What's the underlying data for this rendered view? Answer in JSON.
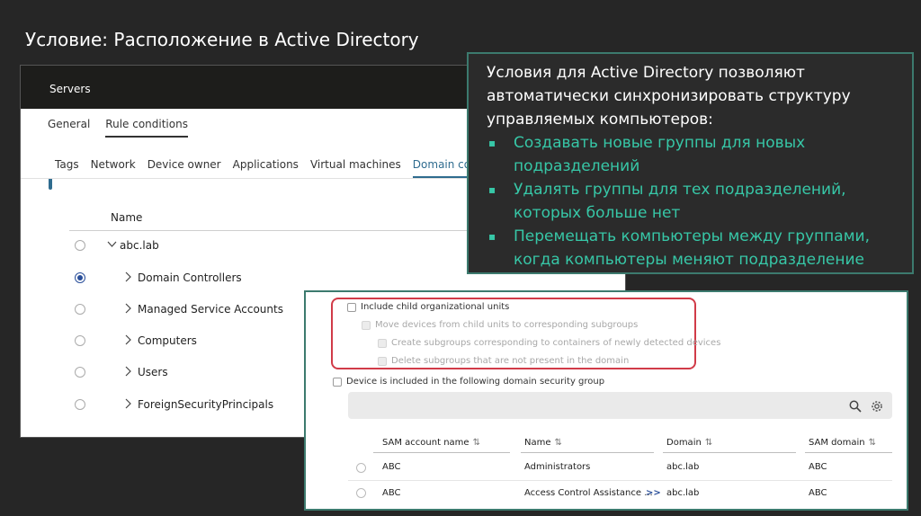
{
  "slide": {
    "title": "Условие: Расположение в Active Directory"
  },
  "left_window": {
    "header": "Servers",
    "main_tabs": [
      "General",
      "Rule conditions"
    ],
    "sub_tabs": [
      "Tags",
      "Network",
      "Device owner",
      "Applications",
      "Virtual machines",
      "Domain controller"
    ],
    "column_header": "Name",
    "tree": [
      {
        "label": "abc.lab",
        "expanded": true,
        "selected": false
      },
      {
        "label": "Domain Controllers",
        "selected": true
      },
      {
        "label": "Managed Service Accounts",
        "selected": false
      },
      {
        "label": "Computers",
        "selected": false
      },
      {
        "label": "Users",
        "selected": false
      },
      {
        "label": "ForeignSecurityPrincipals",
        "selected": false
      }
    ]
  },
  "callout": {
    "intro": "Условия для Active Directory позволяют автоматически синхронизировать структуру управляемых компьютеров:",
    "bullets": [
      "Создавать новые группы для новых подразделений",
      "Удалять группы для тех подразделений, которых больше нет",
      "Перемещать компьютеры между группами, когда компьютеры меняют подразделение"
    ],
    "bullet_glyph": "▪",
    "accent_color": "#37c7a7",
    "border_color": "#3c7a6e"
  },
  "right_window": {
    "checkboxes": [
      {
        "label": "Include child organizational units",
        "enabled": true
      },
      {
        "label": "Move devices from child units to corresponding subgroups",
        "enabled": false
      },
      {
        "label": "Create subgroups corresponding to containers of newly detected devices",
        "enabled": false
      },
      {
        "label": "Delete subgroups that are not present in the domain",
        "enabled": false
      },
      {
        "label": "Device is included in the following domain security group",
        "enabled": true
      }
    ],
    "highlight_color": "#d13b48",
    "table": {
      "columns": [
        "SAM account name",
        "Name",
        "Domain",
        "SAM domain"
      ],
      "sort_glyph": "⇅",
      "expand_glyph": ">>",
      "rows": [
        [
          "ABC",
          "Administrators",
          "abc.lab",
          "ABC"
        ],
        [
          "ABC",
          "Access Control Assistance ...",
          "abc.lab",
          "ABC"
        ]
      ]
    }
  }
}
